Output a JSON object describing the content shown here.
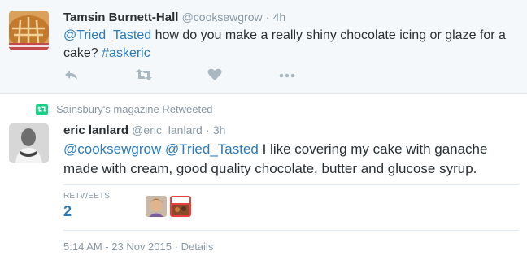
{
  "parent_tweet": {
    "name": "Tamsin Burnett-Hall",
    "handle": "@cooksewgrow",
    "separator": "·",
    "time": "4h",
    "mention": "@Tried_Tasted",
    "text_part1": " how do you make a really shiny chocolate icing or glaze for a",
    "text_part2": "cake? ",
    "hashtag": "#askeric",
    "actions": [
      "reply-icon",
      "retweet-icon",
      "like-icon",
      "more-icon"
    ]
  },
  "retweet_context": {
    "text": "Sainsbury's magazine Retweeted",
    "icon": "retweet-icon"
  },
  "main_tweet": {
    "name": "eric lanlard",
    "handle": "@eric_lanlard",
    "separator": "·",
    "time": "3h",
    "mention1": "@cooksewgrow",
    "mention2": "@Tried_Tasted",
    "text_part1": " I like covering my cake with ganache",
    "text_part2": "made with cream, good quality chocolate, butter and glucose syrup.",
    "stats": {
      "label": "RETWEETS",
      "value": "2"
    },
    "timestamp": "5:14 AM - 23 Nov 2015",
    "details_separator": "·",
    "details_label": "Details"
  },
  "colors": {
    "link": "#2b7bb9",
    "muted": "#8899a6",
    "retweet_green": "#19cf86"
  }
}
